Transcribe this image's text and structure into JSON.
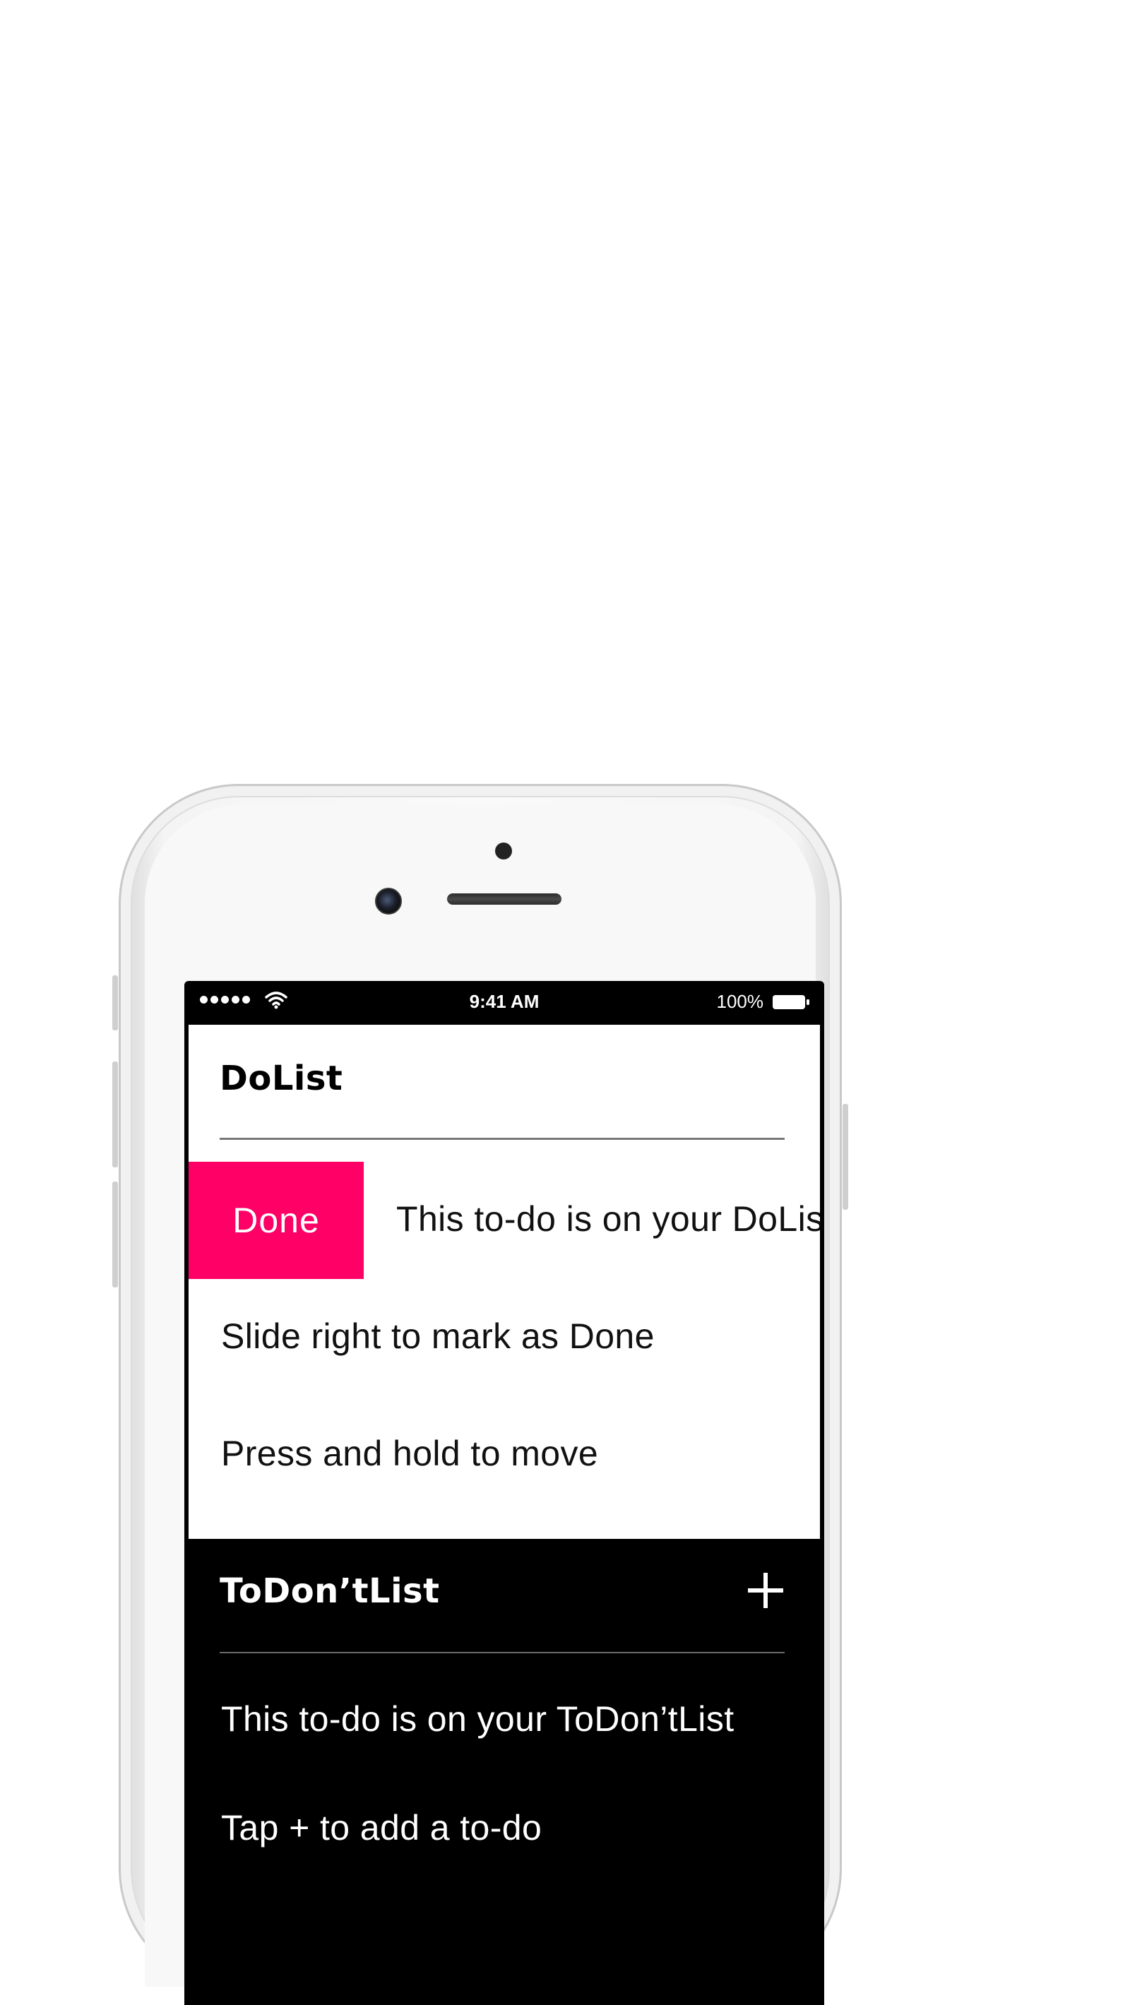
{
  "status_bar": {
    "time": "9:41 AM",
    "battery": "100%",
    "signal_icon": "signal-dots-icon",
    "wifi_icon": "wifi-icon",
    "battery_icon": "battery-icon"
  },
  "dolist": {
    "title": "DoList",
    "done_label": "Done",
    "items": [
      "This to-do is on your DoList",
      "Slide right to mark as Done",
      "Press and hold to move"
    ]
  },
  "todontlist": {
    "title": "ToDon’tList",
    "add_icon": "plus-icon",
    "items": [
      "This to-do is on your ToDon’tList",
      "Tap + to add a to-do"
    ]
  },
  "colors": {
    "accent": "#ff0066",
    "dark_background": "#000000",
    "light_background": "#ffffff"
  }
}
